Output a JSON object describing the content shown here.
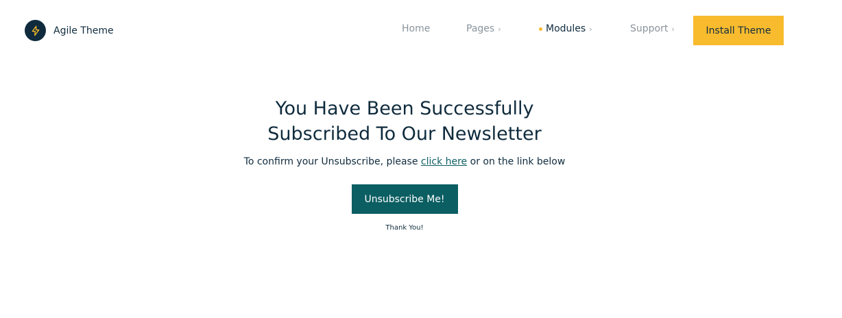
{
  "brand": {
    "name": "Agile Theme",
    "icon": "lightning-bolt-icon",
    "badge_color": "#0f2b3d",
    "icon_color": "#f6b92b"
  },
  "nav": {
    "items": [
      {
        "label": "Home",
        "has_chevron": false,
        "active": false
      },
      {
        "label": "Pages",
        "has_chevron": true,
        "active": false
      },
      {
        "label": "Modules",
        "has_chevron": true,
        "active": true
      },
      {
        "label": "Support",
        "has_chevron": true,
        "active": false
      }
    ],
    "chevron_glyph": "›",
    "install_label": "Install Theme",
    "install_color": "#f8bb2e"
  },
  "main": {
    "title_line1": "You Have Been Successfully",
    "title_line2": "Subscribed To Our Newsletter",
    "subtitle_before": "To confirm your Unsubscribe, please",
    "subtitle_link": "click here",
    "subtitle_after": "or on the link below",
    "button_label": "Unsubscribe Me!",
    "button_color": "#0b5e62",
    "thanks": "Thank You!"
  }
}
